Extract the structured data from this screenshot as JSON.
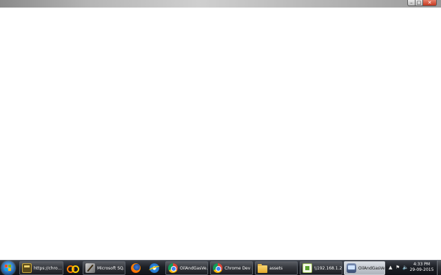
{
  "window": {
    "controls": {
      "minimize": "–",
      "maximize": "□",
      "close": "✕"
    }
  },
  "taskbar": {
    "items": [
      {
        "label": "https://chro...",
        "icon": "window-icon"
      },
      {
        "label": "",
        "icon": "infinity-icon"
      },
      {
        "label": "Microsoft SQ...",
        "icon": "tools-icon"
      },
      {
        "label": "",
        "icon": "firefox-icon"
      },
      {
        "label": "",
        "icon": "internet-explorer-icon"
      },
      {
        "label": "OilAndGasVe...",
        "icon": "chrome-icon"
      },
      {
        "label": "Chrome Dev ...",
        "icon": "chrome-icon"
      },
      {
        "label": "assets",
        "icon": "folder-icon"
      },
      {
        "label": "\\\\192.168.1.2...",
        "icon": "document-icon"
      },
      {
        "label": "OilAndGasVeri...",
        "icon": "remote-desktop-icon"
      }
    ],
    "tray": {
      "chevron": "▲",
      "flag": "⚑",
      "volume": "🔈",
      "time": "4:33 PM",
      "date": "29-09-2015"
    }
  }
}
